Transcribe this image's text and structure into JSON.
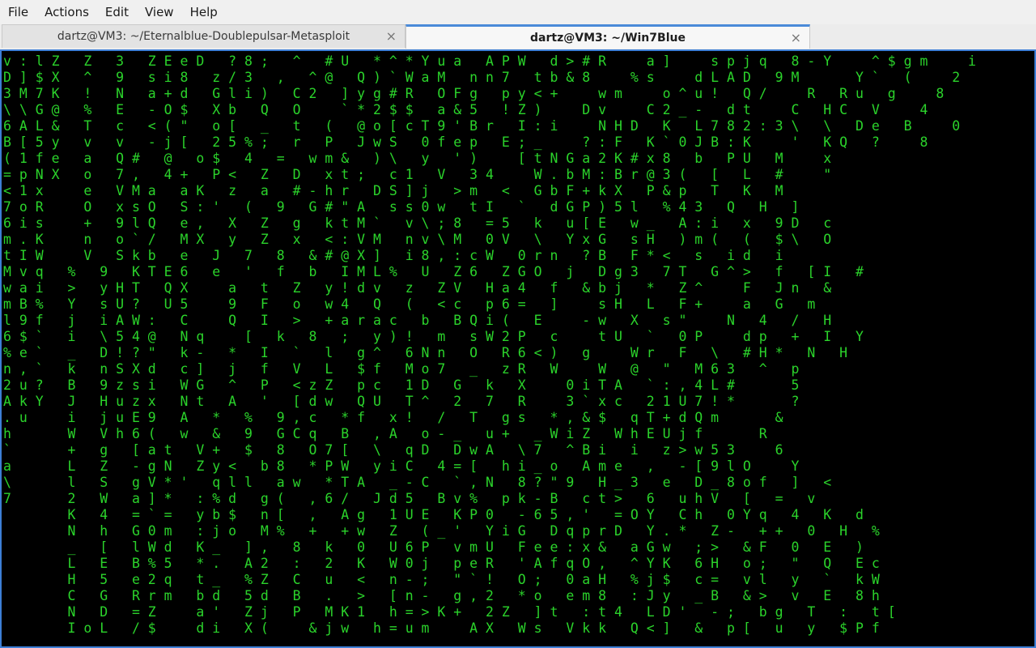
{
  "menubar": {
    "items": [
      "File",
      "Actions",
      "Edit",
      "View",
      "Help"
    ]
  },
  "tabs": [
    {
      "title": "dartz@VM3: ~/Eternalblue-Doublepulsar-Metasploit",
      "active": false
    },
    {
      "title": "dartz@VM3: ~/Win7Blue",
      "active": true
    }
  ],
  "icons": {
    "tab_close": "close-icon"
  },
  "colors": {
    "terminal_background": "#000000",
    "matrix_text": "#2bd32b",
    "active_tab_accent": "#4a8ad8",
    "terminal_border": "#3d7fd6"
  },
  "terminal": {
    "lines": [
      "v : l Z   Z   3   Z E e D   ? 8 ;   ^   # U   * ^ * Y u a   A P W   d > # R     a ]     s p j q   8 - Y     ^ $ g m     i",
      "D ] $ X   ^   9   s i 8   z / 3   ,   ^ @   Q ) ` W a M   n n 7   t b & 8     % s     d L A D   9 M       Y `   (     2",
      "3 M 7 K   !   N   a + d   G l i )   C 2   ] y g # R   O F g   p y < +     w m     o ^ u !   Q /     R   R u   g     8",
      "\\ \\ G @   %   E   - O $   X b   Q   O     ` * 2 $ $   a & 5   ! Z )     D v     C 2 _ -   d t     C   H C   V     4",
      "6 A L &   T   c   < ( \"   o [   _   t   (   @ o [ c T 9 ' B r   I : i     N H D   K   L 7 8 2 : 3 \\   \\   D e   B     0",
      "B [ 5 y   v   v   - j [   2 5 % ;   r   P   J w S   0 f e p   E ; _     ? : F   K ` 0 J B : K     '   K Q   ?     8",
      "( 1 f e   a   Q #   @   o $   4   =   w m &   ) \\   y   ' )     [ t N G a 2 K # x 8   b   P U   M     x",
      "= p N X   o   7 ,   4 +   P <   Z   D   x t ;   c 1   V   3 4     W . b M : B r @ 3 (   [   L   #     \"",
      "< 1 x     e   V M a   a K   z   a   # - h r   D S ] j   > m   <   G b F + k X   P & p   T   K   M",
      "7 o R     O   x s O   S : '   (   9   G # \" A   s s 0 w   t I   `   d G P ) 5 l   % 4 3   Q   H   ]",
      "6 i s     +   9 l Q   e ,   X   Z   g   k t M `   v \\ ; 8   = 5   k   u [ E   w _   A : i   x   9 D   c",
      "m . K     n   o ` /   M X   y   Z   x   < : V M   n v \\ M   0 V   \\   Y x G   s H   ) m (   (   $ \\   O",
      "t I W     V   S k b   e   J   7   8   & # @ X ]   i 8 , : c W   0 r n   ? B   F * <   s   i d   i",
      "M v q   %   9   K T E 6   e   '   f   b   I M L %   U   Z 6   Z G O   j   D g 3   7 T   G ^ >   f   [ I   #",
      "w a i   >   y H T   Q X     a   t   Z   y ! d v   z   Z V   H a 4   f   & b j   *   Z ^     F   J n   &",
      "m B %   Y   s U ?   U 5     9   F   o   w 4   Q   (   < c   p 6 =   ]     s H   L   F +     a   G   m",
      "l 9 f   j   i A W :   C     Q   I   >   + a r a c   b   B Q i (   E     - w   X   s \"     N   4   /   H",
      "6 $ `   i   \\ 5 4 @   N q     [   k   8   ;   y ) !   m   s W 2 P   c     t U   `   0 P     d p   +   I   Y",
      "% e `   _   D ! ? \"   k -   *   I   `   l   g ^   6 N n   O   R 6 < )   g     W r   F   \\   # H *   N   H",
      "n , `   k   n S X d   c ]   j   f   V   L   $ f   M o 7   _   z R   W     W   @   \"   M 6 3   ^   p",
      "2 u ?   B   9 z s i   W G   ^   P   < z Z   p c   1 D   G   k   X     0 i T A   ` : , 4 L #       5",
      "A k Y   J   H u z x   N t   A   '   [ d w   Q U   T ^   2   7   R     3 ` x c   2 1 U 7 ! *       ?",
      ". u     i   j u E 9   A   *   %   9 , c   * f   x !   /   T   g s   * , & $   q T + d Q m       &",
      "h       W   V h 6 (   w   &   9   G C q   B   , A   o - _   u +   _ W i Z   W h E U j f       R",
      "`       +   g   [ a t   V +   $   8   O 7 [   \\   q D   D w A   \\ 7   ^ B i   i   z > w 5 3     6",
      "a       L   Z   - g N   Z y <   b 8   * P W   y i C   4 = [   h i _ o   A m e   ,   - [ 9 l O     Y",
      "\\       l   S   g V * '   q l l   a w   * T A   _ - C   ` , N   8 ? \" 9   H _ 3   e   D _ 8 o f   ]   <",
      "7       2   W   a ] *   : % d   g (   , 6 /   J d 5   B v %   p k - B   c t >   6   u h V   [   =   v",
      "        K   4   = ` =   y b $   n [   ,   A g   1 U E   K P 0   - 6 5 , '   = O Y   C h   0 Y q   4   K   d",
      "        N   h   G 0 m   : j o   M %   +   + w   Z   ( _ '   Y i G   D q p r D   Y . *   Z -   + +   0   H   %",
      "        _   [   l W d   K _   ] ,   8   k   0   U 6 P   v m U   F e e : x &   a G w   ; >   & F   0   E   )",
      "        L   E   B % 5   * .   A 2   :   2   K   W 0 j   p e R   ' A f q O ,   ^ Y K   6 H   o ;   \"   Q   E c",
      "        H   5   e 2 q   t _   % Z   C   u   <   n - ;   \" ` !   O ;   0 a H   % j $   c =   v l   y   `   k W",
      "        C   G   R r m   b d   5 d   B   .   >   [ n -   g , 2   * o   e m 8   : J y   _ B   & >   v   E   8 h",
      "        N   D   = Z     a '   Z j   P   M K 1   h = > K +   2 Z   ] t   : t 4   L D '   - ;   b g   T   :   t [",
      "        I o L   / $     d i   X (     & j w   h = u m     A X   W s   V k k   Q < ]   &   p [   u   y   $ P f"
    ]
  }
}
